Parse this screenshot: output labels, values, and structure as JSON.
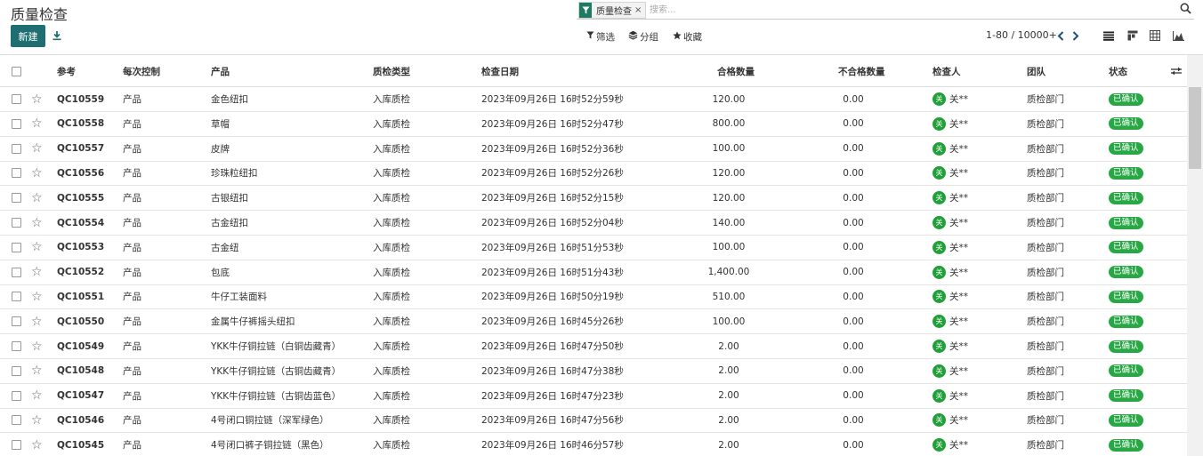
{
  "page": {
    "title": "质量检查",
    "new_button": "新建",
    "download_icon": "download-icon"
  },
  "search": {
    "facet_icon": "filter-icon",
    "facet_label": "质量检查",
    "facet_close": "×",
    "placeholder": "搜索...",
    "value": ""
  },
  "filters": {
    "filter_label": "筛选",
    "group_label": "分组",
    "favorites_label": "收藏"
  },
  "pager": {
    "value": "1-80 / 10000+",
    "prev_icon": "chevron-left-icon",
    "next_icon": "chevron-right-icon"
  },
  "views": [
    "list-view-icon",
    "kanban-view-icon",
    "pivot-view-icon",
    "graph-view-icon"
  ],
  "table": {
    "columns": {
      "reference": "参考",
      "control": "每次控制",
      "product": "产品",
      "qc_type": "质检类型",
      "date": "检查日期",
      "qty_ok": "合格数量",
      "qty_fail": "不合格数量",
      "inspector": "检查人",
      "team": "团队",
      "status": "状态"
    },
    "rows": [
      {
        "ref": "QC10559",
        "control": "产品",
        "product": "金色纽扣",
        "qc_type": "入库质检",
        "date": "2023年09月26日 16时52分59秒",
        "qty_ok": "120.00",
        "qty_fail": "0.00",
        "avatar": "关",
        "inspector": "关**",
        "team": "质检部门",
        "status": "已确认"
      },
      {
        "ref": "QC10558",
        "control": "产品",
        "product": "草帽",
        "qc_type": "入库质检",
        "date": "2023年09月26日 16时52分47秒",
        "qty_ok": "800.00",
        "qty_fail": "0.00",
        "avatar": "关",
        "inspector": "关**",
        "team": "质检部门",
        "status": "已确认"
      },
      {
        "ref": "QC10557",
        "control": "产品",
        "product": "皮牌",
        "qc_type": "入库质检",
        "date": "2023年09月26日 16时52分36秒",
        "qty_ok": "100.00",
        "qty_fail": "0.00",
        "avatar": "关",
        "inspector": "关**",
        "team": "质检部门",
        "status": "已确认"
      },
      {
        "ref": "QC10556",
        "control": "产品",
        "product": "珍珠粒纽扣",
        "qc_type": "入库质检",
        "date": "2023年09月26日 16时52分26秒",
        "qty_ok": "120.00",
        "qty_fail": "0.00",
        "avatar": "关",
        "inspector": "关**",
        "team": "质检部门",
        "status": "已确认"
      },
      {
        "ref": "QC10555",
        "control": "产品",
        "product": "古银纽扣",
        "qc_type": "入库质检",
        "date": "2023年09月26日 16时52分15秒",
        "qty_ok": "120.00",
        "qty_fail": "0.00",
        "avatar": "关",
        "inspector": "关**",
        "team": "质检部门",
        "status": "已确认"
      },
      {
        "ref": "QC10554",
        "control": "产品",
        "product": "古金纽扣",
        "qc_type": "入库质检",
        "date": "2023年09月26日 16时52分04秒",
        "qty_ok": "140.00",
        "qty_fail": "0.00",
        "avatar": "关",
        "inspector": "关**",
        "team": "质检部门",
        "status": "已确认"
      },
      {
        "ref": "QC10553",
        "control": "产品",
        "product": "古金纽",
        "qc_type": "入库质检",
        "date": "2023年09月26日 16时51分53秒",
        "qty_ok": "100.00",
        "qty_fail": "0.00",
        "avatar": "关",
        "inspector": "关**",
        "team": "质检部门",
        "status": "已确认"
      },
      {
        "ref": "QC10552",
        "control": "产品",
        "product": "包底",
        "qc_type": "入库质检",
        "date": "2023年09月26日 16时51分43秒",
        "qty_ok": "1,400.00",
        "qty_fail": "0.00",
        "avatar": "关",
        "inspector": "关**",
        "team": "质检部门",
        "status": "已确认"
      },
      {
        "ref": "QC10551",
        "control": "产品",
        "product": "牛仔工装面料",
        "qc_type": "入库质检",
        "date": "2023年09月26日 16时50分19秒",
        "qty_ok": "510.00",
        "qty_fail": "0.00",
        "avatar": "关",
        "inspector": "关**",
        "team": "质检部门",
        "status": "已确认"
      },
      {
        "ref": "QC10550",
        "control": "产品",
        "product": "金属牛仔裤摇头纽扣",
        "qc_type": "入库质检",
        "date": "2023年09月26日 16时45分26秒",
        "qty_ok": "100.00",
        "qty_fail": "0.00",
        "avatar": "关",
        "inspector": "关**",
        "team": "质检部门",
        "status": "已确认"
      },
      {
        "ref": "QC10549",
        "control": "产品",
        "product": "YKK牛仔铜拉链（白铜齿藏青）",
        "qc_type": "入库质检",
        "date": "2023年09月26日 16时47分50秒",
        "qty_ok": "2.00",
        "qty_fail": "0.00",
        "avatar": "关",
        "inspector": "关**",
        "team": "质检部门",
        "status": "已确认"
      },
      {
        "ref": "QC10548",
        "control": "产品",
        "product": "YKK牛仔铜拉链（古铜齿藏青）",
        "qc_type": "入库质检",
        "date": "2023年09月26日 16时47分38秒",
        "qty_ok": "2.00",
        "qty_fail": "0.00",
        "avatar": "关",
        "inspector": "关**",
        "team": "质检部门",
        "status": "已确认"
      },
      {
        "ref": "QC10547",
        "control": "产品",
        "product": "YKK牛仔铜拉链（古铜齿蓝色）",
        "qc_type": "入库质检",
        "date": "2023年09月26日 16时47分23秒",
        "qty_ok": "2.00",
        "qty_fail": "0.00",
        "avatar": "关",
        "inspector": "关**",
        "team": "质检部门",
        "status": "已确认"
      },
      {
        "ref": "QC10546",
        "control": "产品",
        "product": "4号闭口铜拉链（深军绿色）",
        "qc_type": "入库质检",
        "date": "2023年09月26日 16时47分56秒",
        "qty_ok": "2.00",
        "qty_fail": "0.00",
        "avatar": "关",
        "inspector": "关**",
        "team": "质检部门",
        "status": "已确认"
      },
      {
        "ref": "QC10545",
        "control": "产品",
        "product": "4号闭口裤子铜拉链（黑色）",
        "qc_type": "入库质检",
        "date": "2023年09月26日 16时46分57秒",
        "qty_ok": "2.00",
        "qty_fail": "0.00",
        "avatar": "关",
        "inspector": "关**",
        "team": "质检部门",
        "status": "已确认"
      }
    ]
  },
  "colors": {
    "primary": "#1f6f72",
    "facet": "#1f7a63",
    "status_green": "#28a745",
    "avatar_green": "#21a03a"
  }
}
